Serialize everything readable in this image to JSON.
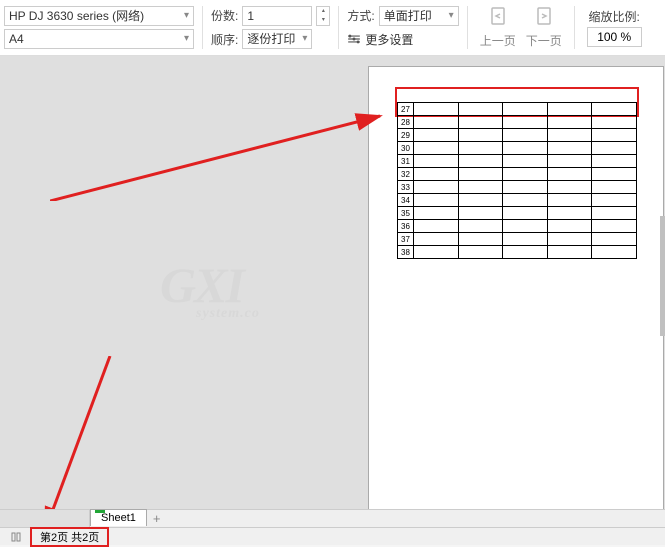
{
  "toolbar": {
    "printer": "HP DJ 3630 series (网络)",
    "paper": "A4",
    "copies_label": "份数:",
    "copies_value": "1",
    "order_label": "顺序:",
    "order_value": "逐份打印",
    "duplex_label": "方式:",
    "duplex_value": "单面打印",
    "more_settings": "更多设置",
    "prev_page": "上一页",
    "next_page": "下一页",
    "zoom_label": "缩放比例:",
    "zoom_value": "100 %"
  },
  "tabs": {
    "sheet_name": "Sheet1",
    "add": "+"
  },
  "status": {
    "page_text": "第2页 共2页"
  },
  "preview": {
    "row_start": 27,
    "row_numbers": [
      "27",
      "28",
      "29",
      "30",
      "31",
      "32",
      "33",
      "34",
      "35",
      "36",
      "37",
      "38"
    ],
    "cols": 5
  },
  "watermark": {
    "big": "GXI",
    "small": "system.co"
  }
}
